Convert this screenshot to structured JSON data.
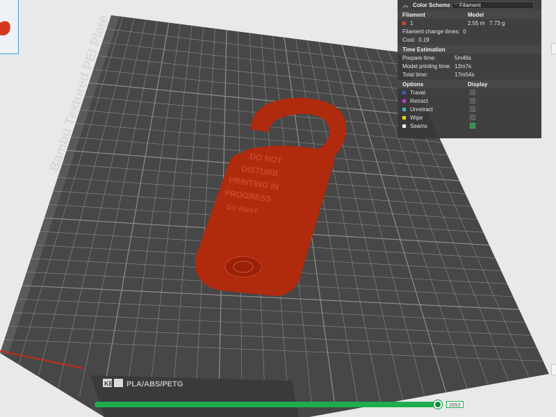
{
  "plate": {
    "title": "Bambu Textured PEI Plate",
    "label_tags": "PLA/ABS/PETG",
    "colors": {
      "base": "#474747",
      "grid": "#9a9a9a",
      "model": "#b02a0d"
    }
  },
  "tag_text": {
    "lines": [
      "DO NOT",
      "DISTURB",
      "PRINTING IN",
      "PROGRESS",
      "GO AWAY"
    ]
  },
  "legend": {
    "color_scheme_label": "Color Scheme",
    "color_scheme_value": "Filament",
    "filament_header": "Filament",
    "model_header": "Model",
    "filament_index": "1",
    "filament_color": "#d14a1f",
    "model_length": "2.55 m",
    "model_weight": "7.73 g",
    "change_times_label": "Filament change times:",
    "change_times_value": "0",
    "cost_label": "Cost:",
    "cost_value": "0.19",
    "time_header": "Time Estimation",
    "prepare_label": "Prepare time:",
    "prepare_value": "5m46s",
    "model_time_label": "Model printing time:",
    "model_time_value": "12m7s",
    "total_label": "Total time:",
    "total_value": "17m54s",
    "options_header": "Options",
    "display_header": "Display",
    "options": [
      {
        "label": "Travel",
        "color": "#3b5bd8",
        "checked": false
      },
      {
        "label": "Retract",
        "color": "#c03ad8",
        "checked": false
      },
      {
        "label": "Unretract",
        "color": "#38b8c8",
        "checked": false
      },
      {
        "label": "Wipe",
        "color": "#e8d800",
        "checked": false
      },
      {
        "label": "Seams",
        "color": "#f0f0f0",
        "checked": true
      }
    ]
  },
  "slider": {
    "value": "2653",
    "accent": "#1dad4b"
  }
}
